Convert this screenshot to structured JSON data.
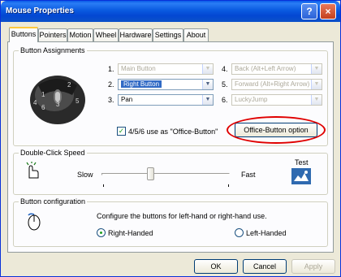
{
  "window": {
    "title": "Mouse Properties",
    "help_label": "?",
    "close_label": "×"
  },
  "tabs": [
    {
      "label": "Buttons",
      "active": true
    },
    {
      "label": "Pointers"
    },
    {
      "label": "Motion"
    },
    {
      "label": "Wheel"
    },
    {
      "label": "Hardware"
    },
    {
      "label": "Settings"
    },
    {
      "label": "About"
    }
  ],
  "assignments": {
    "legend": "Button Assignments",
    "rows": [
      {
        "num": "1.",
        "value": "Main Button",
        "state": "disabled"
      },
      {
        "num": "2.",
        "value": "Right Button",
        "state": "selected"
      },
      {
        "num": "3.",
        "value": "Pan",
        "state": "normal"
      },
      {
        "num": "4.",
        "value": "Back (Alt+Left Arrow)",
        "state": "disabled"
      },
      {
        "num": "5.",
        "value": "Forward (Alt+Right Arrow)",
        "state": "disabled"
      },
      {
        "num": "6.",
        "value": "LuckyJump",
        "state": "disabled"
      }
    ],
    "office_check_label": "4/5/6 use as \"Office-Button\"",
    "office_checked": true,
    "office_button_label": "Office-Button option",
    "mouse_numbers": [
      "1",
      "2",
      "3",
      "4",
      "5",
      "6"
    ]
  },
  "doubleclick": {
    "legend": "Double-Click Speed",
    "slow_label": "Slow",
    "fast_label": "Fast",
    "test_label": "Test",
    "speed_fraction": 0.38
  },
  "configuration": {
    "legend": "Button configuration",
    "description": "Configure the buttons for left-hand or right-hand use.",
    "right_label": "Right-Handed",
    "left_label": "Left-Handed",
    "selected": "right"
  },
  "footer": {
    "ok_label": "OK",
    "cancel_label": "Cancel",
    "apply_label": "Apply"
  },
  "colors": {
    "titlebar": "#0a5ae0",
    "selection": "#316ac5",
    "annotation_ring": "#e00000"
  }
}
